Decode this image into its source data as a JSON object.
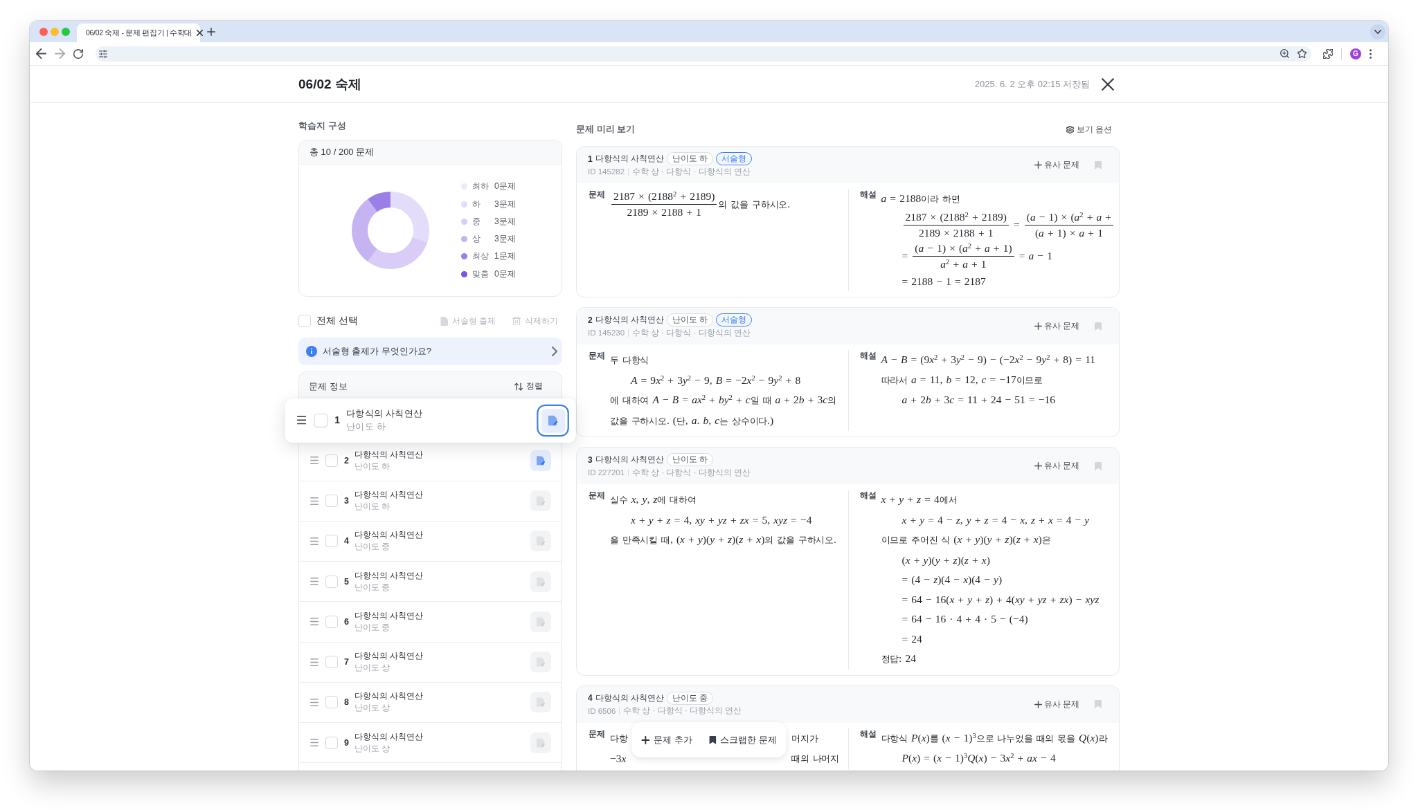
{
  "browser": {
    "tab_title": "06/02 숙제 - 문제 편집기 | 수학대",
    "profile_initial": "G"
  },
  "header": {
    "title": "06/02 숙제",
    "saved_status": "2025. 6. 2 오후 02:15 저장됨"
  },
  "composition": {
    "heading": "학습지 구성",
    "total": "총 10 / 200 문제",
    "chart_data": {
      "type": "donut",
      "categories": [
        "최하",
        "하",
        "중",
        "상",
        "최상",
        "맞춤"
      ],
      "values": [
        0,
        3,
        3,
        3,
        1,
        0
      ],
      "data_labels": true,
      "value_labels": [
        "0문제",
        "3문제",
        "3문제",
        "3문제",
        "1문제",
        "0문제"
      ],
      "legend": "right"
    },
    "legend": [
      {
        "color": "#eee9fc"
      },
      {
        "color": "#e4ddfa"
      },
      {
        "color": "#d9cdf7"
      },
      {
        "color": "#c5b3f2"
      },
      {
        "color": "#9b7fe9"
      },
      {
        "color": "#7a52e6"
      }
    ]
  },
  "selection": {
    "select_all": {
      "label": "전체 선택",
      "checked": false
    },
    "actions": [
      {
        "kind": "essay",
        "label": "서술형 출제",
        "disabled": true
      },
      {
        "kind": "delete",
        "label": "삭제하기",
        "disabled": true
      }
    ]
  },
  "info_banner": {
    "text": "서술형 출제가 무엇인가요?"
  },
  "problem_list": {
    "title": "문제 정보",
    "sort_label": "정렬",
    "rows": [
      {
        "number": "1",
        "title": "다항식의 사칙연산",
        "difficulty": "난이도 하",
        "checked": false,
        "essay": true,
        "dragging": true
      },
      {
        "number": "2",
        "title": "다항식의 사칙연산",
        "difficulty": "난이도 하",
        "checked": false,
        "essay": true,
        "dragging": false
      },
      {
        "number": "3",
        "title": "다항식의 사칙연산",
        "difficulty": "난이도 하",
        "checked": false,
        "essay": false,
        "dragging": false
      },
      {
        "number": "4",
        "title": "다항식의 사칙연산",
        "difficulty": "난이도 중",
        "checked": false,
        "essay": false,
        "dragging": false
      },
      {
        "number": "5",
        "title": "다항식의 사칙연산",
        "difficulty": "난이도 중",
        "checked": false,
        "essay": false,
        "dragging": false
      },
      {
        "number": "6",
        "title": "다항식의 사칙연산",
        "difficulty": "난이도 중",
        "checked": false,
        "essay": false,
        "dragging": false
      },
      {
        "number": "7",
        "title": "다항식의 사칙연산",
        "difficulty": "난이도 상",
        "checked": false,
        "essay": false,
        "dragging": false
      },
      {
        "number": "8",
        "title": "다항식의 사칙연산",
        "difficulty": "난이도 상",
        "checked": false,
        "essay": false,
        "dragging": false
      },
      {
        "number": "9",
        "title": "다항식의 사칙연산",
        "difficulty": "난이도 상",
        "checked": false,
        "essay": false,
        "dragging": false
      }
    ]
  },
  "preview": {
    "heading": "문제 미리 보기",
    "options_label": "보기 옵션",
    "cards": [
      {
        "number": "1",
        "title": "다항식의 사칙연산",
        "tags": [
          {
            "kind": "difficulty",
            "label": "난이도 하"
          },
          {
            "kind": "essay",
            "label": "서술형"
          }
        ],
        "id": "ID 145282",
        "path": "수학 상 · 다항식 · 다항식의 연산",
        "similar_label": "유사 문제",
        "bookmarked": false,
        "problem": {
          "label": "문제",
          "lines": [
            {
              "kind": "text",
              "parts": [
                {
                  "kind": "frac",
                  "num": "2187 × (2188$^{2}$ + 2189)",
                  "den": "2189 × 2188 + 1"
                },
                {
                  "kind": "text",
                  "text": "의 값을 구하시오."
                }
              ]
            }
          ]
        },
        "solution": {
          "label": "해설",
          "lines": [
            {
              "kind": "text",
              "parts": [
                {
                  "kind": "text",
                  "text": "a = 2188이라 하면"
                }
              ]
            },
            {
              "kind": "display",
              "parts": [
                {
                  "kind": "frac",
                  "num": "2187 × (2188$^{2}$ + 2189)",
                  "den": "2189 × 2188 + 1"
                },
                {
                  "kind": "text",
                  "text": " = "
                },
                {
                  "kind": "frac",
                  "num": "(a − 1) × (a$^{2}$ + a +",
                  "den": "(a + 1) × a + 1"
                }
              ]
            },
            {
              "kind": "display",
              "parts": [
                {
                  "kind": "text",
                  "text": "= "
                },
                {
                  "kind": "frac",
                  "num": "(a − 1) × (a$^{2}$ + a + 1)",
                  "den": "a$^{2}$ + a + 1"
                },
                {
                  "kind": "text",
                  "text": " = a − 1"
                }
              ]
            },
            {
              "kind": "display",
              "parts": [
                {
                  "kind": "text",
                  "text": "= 2188 − 1 = 2187"
                }
              ]
            }
          ]
        }
      },
      {
        "number": "2",
        "title": "다항식의 사칙연산",
        "tags": [
          {
            "kind": "difficulty",
            "label": "난이도 하"
          },
          {
            "kind": "essay",
            "label": "서술형"
          }
        ],
        "id": "ID 145230",
        "path": "수학 상 · 다항식 · 다항식의 연산",
        "similar_label": "유사 문제",
        "bookmarked": false,
        "problem": {
          "label": "문제",
          "lines": [
            {
              "kind": "text",
              "parts": [
                {
                  "kind": "text",
                  "text": "두 다항식"
                }
              ]
            },
            {
              "kind": "display",
              "parts": [
                {
                  "kind": "text",
                  "text": "A = 9x$^{2}$ + 3y$^{2}$ − 9, B = −2x$^{2}$ − 9y$^{2}$ + 8"
                }
              ]
            },
            {
              "kind": "text",
              "parts": [
                {
                  "kind": "text",
                  "text": "에 대하여 A − B = ax$^{2}$ + by$^{2}$ + c일 때 a + 2b + 3c의"
                }
              ]
            },
            {
              "kind": "text",
              "parts": [
                {
                  "kind": "text",
                  "text": "값을 구하시오. (단, a. b, c는 상수이다.)"
                }
              ]
            }
          ]
        },
        "solution": {
          "label": "해설",
          "lines": [
            {
              "kind": "text",
              "parts": [
                {
                  "kind": "text",
                  "text": "A − B = (9x$^{2}$ + 3y$^{2}$ − 9) − (−2x$^{2}$ − 9y$^{2}$ + 8) = 11"
                }
              ]
            },
            {
              "kind": "text",
              "parts": [
                {
                  "kind": "text",
                  "text": "따라서 a = 11, b = 12, c = −17이므로"
                }
              ]
            },
            {
              "kind": "display",
              "parts": [
                {
                  "kind": "text",
                  "text": "a + 2b + 3c = 11 + 24 − 51 = −16"
                }
              ]
            }
          ]
        }
      },
      {
        "number": "3",
        "title": "다항식의 사칙연산",
        "tags": [
          {
            "kind": "difficulty",
            "label": "난이도 하"
          }
        ],
        "id": "ID 227201",
        "path": "수학 상 · 다항식 · 다항식의 연산",
        "similar_label": "유사 문제",
        "bookmarked": false,
        "problem": {
          "label": "문제",
          "lines": [
            {
              "kind": "text",
              "parts": [
                {
                  "kind": "text",
                  "text": "실수 x, y, z에 대하여"
                }
              ]
            },
            {
              "kind": "display",
              "parts": [
                {
                  "kind": "text",
                  "text": "x + y + z = 4, xy + yz + zx = 5, xyz = −4"
                }
              ]
            },
            {
              "kind": "text",
              "parts": [
                {
                  "kind": "text",
                  "text": "을 만족시킬 때, (x + y)(y + z)(z + x)의 값을 구하시오."
                }
              ]
            }
          ]
        },
        "solution": {
          "label": "해설",
          "lines": [
            {
              "kind": "text",
              "parts": [
                {
                  "kind": "text",
                  "text": "x + y + z = 4에서"
                }
              ]
            },
            {
              "kind": "display",
              "parts": [
                {
                  "kind": "text",
                  "text": "x + y = 4 − z, y + z = 4 − x, z + x = 4 − y"
                }
              ]
            },
            {
              "kind": "text",
              "parts": [
                {
                  "kind": "text",
                  "text": "이므로 주어진 식 (x + y)(y + z)(z + x)은"
                }
              ]
            },
            {
              "kind": "display",
              "parts": [
                {
                  "kind": "text",
                  "text": "(x + y)(y + z)(z + x)"
                }
              ]
            },
            {
              "kind": "display",
              "parts": [
                {
                  "kind": "text",
                  "text": "= (4 − z)(4 − x)(4 − y)"
                }
              ]
            },
            {
              "kind": "display",
              "parts": [
                {
                  "kind": "text",
                  "text": "= 64 − 16(x + y + z) + 4(xy + yz + zx) − xyz"
                }
              ]
            },
            {
              "kind": "display",
              "parts": [
                {
                  "kind": "text",
                  "text": "= 64 − 16 · 4 + 4 · 5 − (−4)"
                }
              ]
            },
            {
              "kind": "display",
              "parts": [
                {
                  "kind": "text",
                  "text": "= 24"
                }
              ]
            },
            {
              "kind": "text",
              "parts": [
                {
                  "kind": "text",
                  "text": "정답: 24"
                }
              ]
            }
          ]
        }
      },
      {
        "number": "4",
        "title": "다항식의 사칙연산",
        "tags": [
          {
            "kind": "difficulty",
            "label": "난이도 중"
          }
        ],
        "id": "ID 6506",
        "path": "수학 상 · 다항식 · 다항식의 연산",
        "similar_label": "유사 문제",
        "bookmarked": false,
        "problem": {
          "label": "문제",
          "lines": [
            {
              "kind": "split",
              "parts": [
                {
                  "kind": "text",
                  "text": "다항"
                },
                {
                  "kind": "text",
                  "text": "머지가"
                }
              ]
            },
            {
              "kind": "split",
              "parts": [
                {
                  "kind": "text",
                  "text": "−3x"
                },
                {
                  "kind": "text",
                  "text": "때의 나머지"
                }
              ]
            }
          ]
        },
        "solution": {
          "label": "해설",
          "lines": [
            {
              "kind": "text",
              "parts": [
                {
                  "kind": "text",
                  "text": "다항식 P(x)를 (x − 1)$^{3}$으로 나누었을 때의 몫을 Q(x)라"
                }
              ]
            },
            {
              "kind": "display",
              "parts": [
                {
                  "kind": "text",
                  "text": "P(x) = (x − 1)$^{3}$Q(x) − 3x$^{2}$ + ax − 4"
                }
              ]
            }
          ]
        }
      }
    ]
  },
  "floating_bar": {
    "buttons": [
      {
        "kind": "add",
        "label": "문제 추가"
      },
      {
        "kind": "scrap",
        "label": "스크랩한 문제"
      }
    ]
  }
}
